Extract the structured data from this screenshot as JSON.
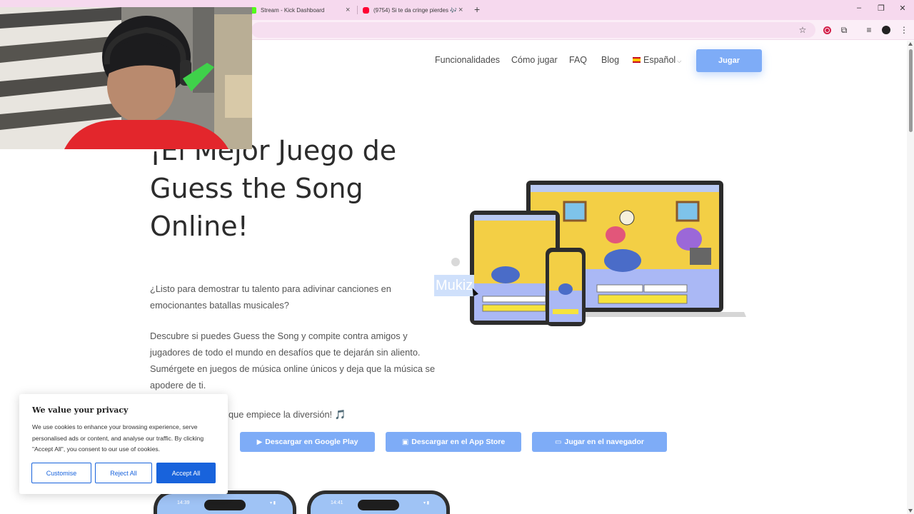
{
  "browser": {
    "tabs": [
      {
        "title": "Stream - Kick Dashboard",
        "favicon": "kick-icon",
        "color": "#53fc18"
      },
      {
        "title": "(9754) Si te da cringe pierdes 🎶",
        "favicon": "youtube-icon",
        "color": "#ff0033"
      }
    ],
    "new_tab": "+",
    "window_controls": {
      "minimize": "–",
      "restore": "❐",
      "close": "✕"
    },
    "toolbar_icons": [
      "star-icon",
      "record-icon",
      "extensions-icon",
      "media-icon",
      "profile-icon",
      "menu-icon"
    ],
    "tabbar_color": "#f6d9ee"
  },
  "nav": {
    "items": [
      "Funcionalidades",
      "Cómo jugar",
      "FAQ",
      "Blog"
    ],
    "language": "Español",
    "play_label": "Jugar"
  },
  "hero": {
    "title": "¡El Mejor Juego de Guess the Song Online!",
    "para1": "¿Listo para demostrar tu talento para adivinar canciones en emocionantes batallas musicales?",
    "para2": "Descubre si puedes Guess the Song y compite contra amigos y jugadores de todo el mundo en desafíos que te dejarán sin aliento. Sumérgete en juegos de música online únicos y deja que la música se apodere de ti.",
    "para3": "que empiece la diversión!",
    "para3_icon": "🎵",
    "selected_text": "Mukiz"
  },
  "buttons": {
    "google_play": "Descargar en Google Play",
    "app_store": "Descargar en el App Store",
    "browser": "Jugar en el navegador"
  },
  "phones": [
    {
      "time": "14:39",
      "status": "▾ ▮"
    },
    {
      "time": "14:41",
      "status": "▾ ▮"
    }
  ],
  "cookie": {
    "title": "We value your privacy",
    "text": "We use cookies to enhance your browsing experience, serve personalised ads or content, and analyse our traffic. By clicking \"Accept All\", you consent to our use of cookies.",
    "customise": "Customise",
    "reject": "Reject All",
    "accept": "Accept All"
  },
  "colors": {
    "accent": "#7eacf7",
    "cookie_accent": "#1863dc"
  }
}
